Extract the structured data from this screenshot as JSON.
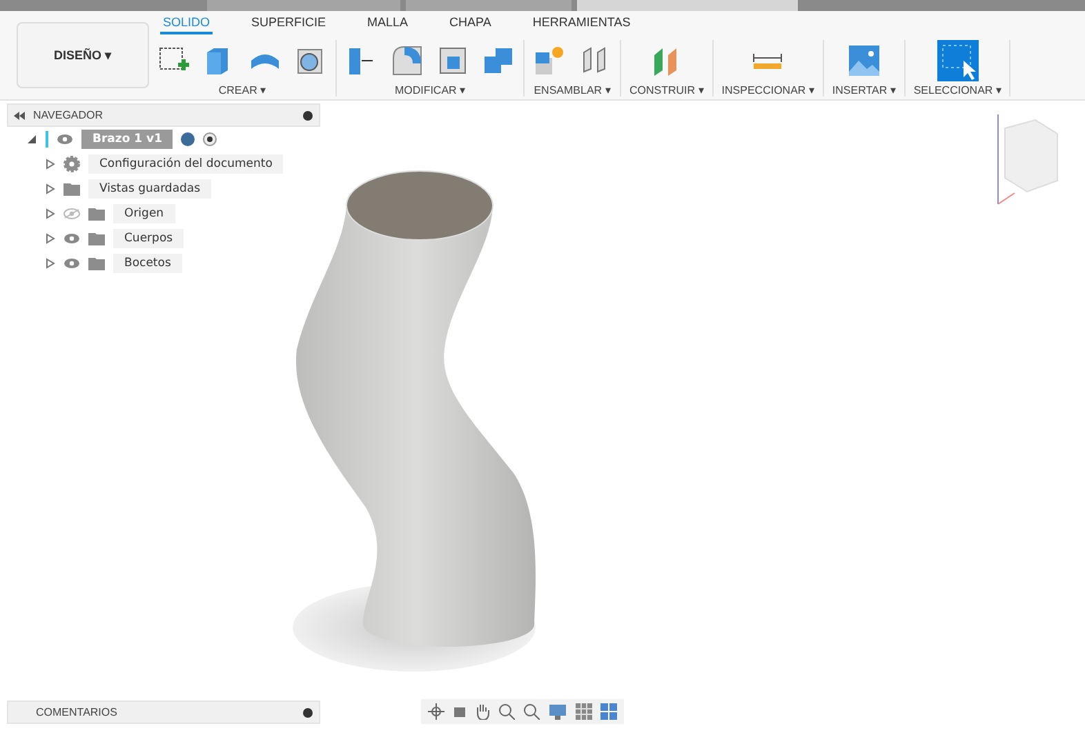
{
  "design_button": {
    "label": "DISEÑO",
    "caret": "▾"
  },
  "tabs": [
    {
      "label": "SOLIDO",
      "selected": true
    },
    {
      "label": "SUPERFICIE",
      "selected": false
    },
    {
      "label": "MALLA",
      "selected": false
    },
    {
      "label": "CHAPA",
      "selected": false
    },
    {
      "label": "HERRAMIENTAS",
      "selected": false
    }
  ],
  "tool_groups": [
    {
      "label": "CREAR ▾"
    },
    {
      "label": "MODIFICAR ▾"
    },
    {
      "label": "ENSAMBLAR ▾"
    },
    {
      "label": "CONSTRUIR ▾"
    },
    {
      "label": "INSPECCIONAR ▾"
    },
    {
      "label": "INSERTAR ▾"
    },
    {
      "label": "SELECCIONAR ▾"
    }
  ],
  "navigator": {
    "title": "NAVEGADOR",
    "root": {
      "label": "Brazo 1 v1",
      "expanded": true,
      "visible": true,
      "selected": true,
      "children": [
        {
          "label": "Configuración del documento",
          "kind": "settings",
          "expanded": false,
          "selected": false
        },
        {
          "label": "Vistas guardadas",
          "kind": "folder",
          "expanded": false,
          "selected": false
        },
        {
          "label": "Origen",
          "kind": "layer",
          "visible": false,
          "expanded": false,
          "selected": false
        },
        {
          "label": "Cuerpos",
          "kind": "layer",
          "visible": true,
          "expanded": false,
          "selected": false
        },
        {
          "label": "Bocetos",
          "kind": "layer",
          "visible": true,
          "expanded": false,
          "selected": false
        }
      ]
    }
  },
  "comments": {
    "title": "COMENTARIOS"
  }
}
